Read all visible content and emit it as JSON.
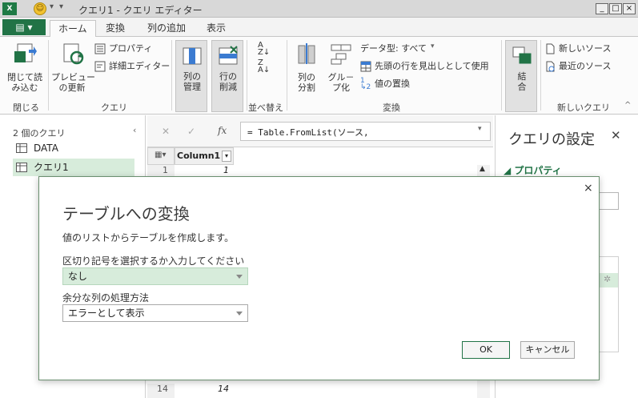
{
  "window": {
    "app_icon": "X",
    "title": "クエリ1 - クエリ エディター",
    "min": "_",
    "max": "□",
    "close": "×"
  },
  "tabs": {
    "file": "▤ ▾",
    "items": [
      "ホーム",
      "変換",
      "列の追加",
      "表示"
    ]
  },
  "ribbon": {
    "close_load": "閉じて読\nみ込む",
    "close_group": "閉じる",
    "preview_refresh": "プレビュー\nの更新",
    "properties": "プロパティ",
    "advanced_editor": "詳細エディター",
    "query_group": "クエリ",
    "manage_columns": "列の\n管理",
    "remove_rows": "行の\n削減",
    "sort_group": "並べ替え",
    "split_column": "列の\n分割",
    "group_by": "グル－\nプ化",
    "data_type": "データ型: すべて",
    "first_row_header": "先頭の行を見出しとして使用",
    "replace_values": "値の置換",
    "transform_group": "変換",
    "merge": "結\n合",
    "new_source": "新しいソース",
    "recent_sources": "最近のソース",
    "new_query_group": "新しいクエリ"
  },
  "left_pane": {
    "header": "2 個のクエリ",
    "queries": [
      "DATA",
      "クエリ1"
    ]
  },
  "formula": {
    "text": "= Table.FromList(ソース,",
    "fx": "fx",
    "cancel": "✕",
    "commit": "✓"
  },
  "grid": {
    "column": "Column1",
    "rows": [
      {
        "num": "1",
        "val": "1"
      },
      {
        "num": "14",
        "val": "14"
      }
    ]
  },
  "settings": {
    "title": "クエリの設定",
    "close": "✕",
    "properties": "プロパティ"
  },
  "dialog": {
    "close": "×",
    "title": "テーブルへの変換",
    "description": "値のリストからテーブルを作成します。",
    "delimiter_label": "区切り記号を選択するか入力してください",
    "delimiter_value": "なし",
    "extra_label": "余分な列の処理方法",
    "extra_value": "エラーとして表示",
    "ok": "OK",
    "cancel": "キャンセル"
  },
  "colors": {
    "accent": "#217346",
    "selection": "#d7ecdb"
  }
}
